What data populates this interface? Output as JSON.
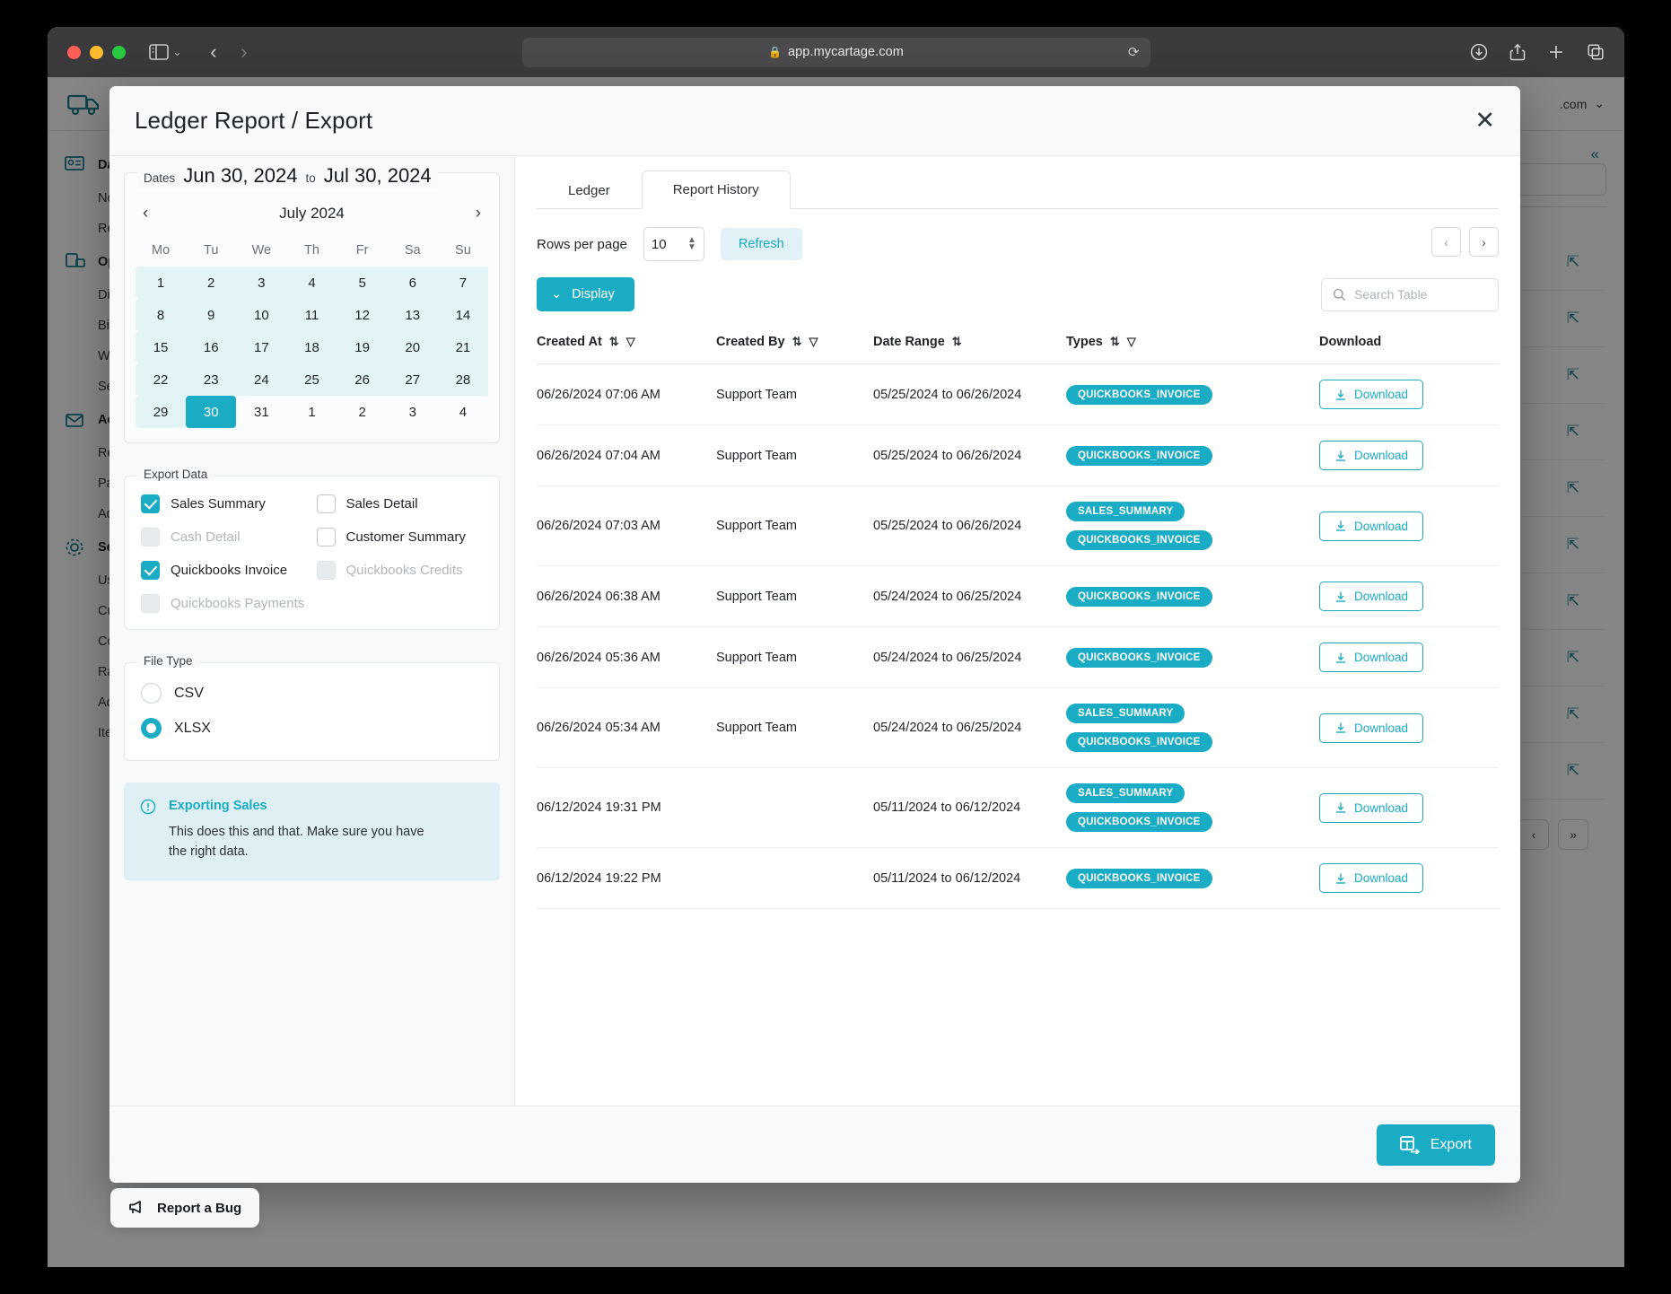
{
  "browser": {
    "url": "app.mycartage.com",
    "lock_icon": "lock-icon",
    "reload_icon": "reload-icon",
    "back_icon": "back-arrow-icon",
    "forward_icon": "forward-arrow-icon",
    "sidebar_icon": "sidebar-toggle-icon",
    "downloads_icon": "downloads-icon",
    "share_icon": "share-icon",
    "newtab_icon": "new-tab-icon",
    "tabs_icon": "tab-overview-icon"
  },
  "app_background": {
    "account_label": ".com",
    "collapse_label": "«",
    "nav": [
      {
        "label": "Da",
        "type": "group",
        "icon": "dashboard-icon"
      },
      {
        "label": "Newsf",
        "type": "item"
      },
      {
        "label": "Report",
        "type": "item"
      },
      {
        "label": "Op",
        "type": "group",
        "icon": "operations-icon"
      },
      {
        "label": "Dispat",
        "type": "item"
      },
      {
        "label": "Billing",
        "type": "item"
      },
      {
        "label": "Wareh",
        "type": "item"
      },
      {
        "label": "Search",
        "type": "item"
      },
      {
        "label": "Ac",
        "type": "group",
        "icon": "accounting-icon"
      },
      {
        "label": "Receiv",
        "type": "item"
      },
      {
        "label": "Payme",
        "type": "item"
      },
      {
        "label": "Adjust",
        "type": "item"
      },
      {
        "label": "Se",
        "type": "group",
        "icon": "settings-gear-icon"
      },
      {
        "label": "Users",
        "type": "item"
      },
      {
        "label": "Custor",
        "type": "item"
      },
      {
        "label": "Codes",
        "type": "item"
      },
      {
        "label": "Rates",
        "type": "item"
      },
      {
        "label": "Addres",
        "type": "item"
      },
      {
        "label": "Items",
        "type": "item"
      }
    ],
    "pager_next": "»"
  },
  "modal": {
    "title": "Ledger Report / Export",
    "close_icon": "close-icon"
  },
  "dates": {
    "legend_label": "Dates",
    "from": "Jun 30, 2024",
    "to_word": "to",
    "to": "Jul 30, 2024"
  },
  "calendar": {
    "month_label": "July 2024",
    "prev_icon": "chevron-left-icon",
    "next_icon": "chevron-right-icon",
    "weekdays": [
      "Mo",
      "Tu",
      "We",
      "Th",
      "Fr",
      "Sa",
      "Su"
    ],
    "weeks": [
      [
        {
          "d": "1",
          "s": "inrange"
        },
        {
          "d": "2",
          "s": "inrange"
        },
        {
          "d": "3",
          "s": "inrange"
        },
        {
          "d": "4",
          "s": "inrange"
        },
        {
          "d": "5",
          "s": "inrange"
        },
        {
          "d": "6",
          "s": "inrange we"
        },
        {
          "d": "7",
          "s": "inrange we"
        }
      ],
      [
        {
          "d": "8",
          "s": "inrange"
        },
        {
          "d": "9",
          "s": "inrange"
        },
        {
          "d": "10",
          "s": "inrange"
        },
        {
          "d": "11",
          "s": "inrange"
        },
        {
          "d": "12",
          "s": "inrange"
        },
        {
          "d": "13",
          "s": "inrange we"
        },
        {
          "d": "14",
          "s": "inrange we"
        }
      ],
      [
        {
          "d": "15",
          "s": "inrange"
        },
        {
          "d": "16",
          "s": "inrange"
        },
        {
          "d": "17",
          "s": "inrange"
        },
        {
          "d": "18",
          "s": "inrange"
        },
        {
          "d": "19",
          "s": "inrange"
        },
        {
          "d": "20",
          "s": "inrange we"
        },
        {
          "d": "21",
          "s": "inrange we"
        }
      ],
      [
        {
          "d": "22",
          "s": "inrange"
        },
        {
          "d": "23",
          "s": "inrange"
        },
        {
          "d": "24",
          "s": "inrange"
        },
        {
          "d": "25",
          "s": "inrange"
        },
        {
          "d": "26",
          "s": "inrange"
        },
        {
          "d": "27",
          "s": "inrange we"
        },
        {
          "d": "28",
          "s": "inrange we"
        }
      ],
      [
        {
          "d": "29",
          "s": "inrange"
        },
        {
          "d": "30",
          "s": "selected"
        },
        {
          "d": "31",
          "s": ""
        },
        {
          "d": "1",
          "s": "out"
        },
        {
          "d": "2",
          "s": "out"
        },
        {
          "d": "3",
          "s": "out"
        },
        {
          "d": "4",
          "s": "out"
        }
      ]
    ]
  },
  "export_data": {
    "legend": "Export Data",
    "options": [
      {
        "label": "Sales Summary",
        "checked": true,
        "disabled": false
      },
      {
        "label": "Sales Detail",
        "checked": false,
        "disabled": false
      },
      {
        "label": "Cash Detail",
        "checked": false,
        "disabled": true
      },
      {
        "label": "Customer Summary",
        "checked": false,
        "disabled": false
      },
      {
        "label": "Quickbooks Invoice",
        "checked": true,
        "disabled": false
      },
      {
        "label": "Quickbooks Credits",
        "checked": false,
        "disabled": true
      },
      {
        "label": "Quickbooks Payments",
        "checked": false,
        "disabled": true
      }
    ]
  },
  "file_type": {
    "legend": "File Type",
    "options": [
      {
        "label": "CSV",
        "selected": false
      },
      {
        "label": "XLSX",
        "selected": true
      }
    ]
  },
  "info": {
    "icon": "info-circle-icon",
    "title": "Exporting Sales",
    "text": "This does this and that. Make sure you have the right data."
  },
  "tabs": [
    {
      "label": "Ledger",
      "active": false
    },
    {
      "label": "Report History",
      "active": true
    }
  ],
  "toolbar": {
    "rows_per_page_label": "Rows per page",
    "rows_per_page_value": "10",
    "refresh_label": "Refresh",
    "display_label": "Display",
    "display_icon": "chevron-down-icon",
    "prev_page_icon": "chevron-left-icon",
    "next_page_icon": "chevron-right-icon",
    "search_placeholder": "Search Table",
    "search_value": "",
    "search_icon": "search-icon"
  },
  "table": {
    "columns": [
      {
        "label": "Created At",
        "sort": true,
        "filter": true
      },
      {
        "label": "Created By",
        "sort": true,
        "filter": true
      },
      {
        "label": "Date Range",
        "sort": true,
        "filter": false
      },
      {
        "label": "Types",
        "sort": true,
        "filter": true
      },
      {
        "label": "Download",
        "sort": false,
        "filter": false
      }
    ],
    "download_label": "Download",
    "download_icon": "download-icon",
    "rows": [
      {
        "created_at": "06/26/2024 07:06 AM",
        "created_by": "Support Team",
        "date_range": "05/25/2024 to 06/26/2024",
        "types": [
          "QUICKBOOKS_INVOICE"
        ]
      },
      {
        "created_at": "06/26/2024 07:04 AM",
        "created_by": "Support Team",
        "date_range": "05/25/2024 to 06/26/2024",
        "types": [
          "QUICKBOOKS_INVOICE"
        ]
      },
      {
        "created_at": "06/26/2024 07:03 AM",
        "created_by": "Support Team",
        "date_range": "05/25/2024 to 06/26/2024",
        "types": [
          "SALES_SUMMARY",
          "QUICKBOOKS_INVOICE"
        ]
      },
      {
        "created_at": "06/26/2024 06:38 AM",
        "created_by": "Support Team",
        "date_range": "05/24/2024 to 06/25/2024",
        "types": [
          "QUICKBOOKS_INVOICE"
        ]
      },
      {
        "created_at": "06/26/2024 05:36 AM",
        "created_by": "Support Team",
        "date_range": "05/24/2024 to 06/25/2024",
        "types": [
          "QUICKBOOKS_INVOICE"
        ]
      },
      {
        "created_at": "06/26/2024 05:34 AM",
        "created_by": "Support Team",
        "date_range": "05/24/2024 to 06/25/2024",
        "types": [
          "SALES_SUMMARY",
          "QUICKBOOKS_INVOICE"
        ]
      },
      {
        "created_at": "06/12/2024 19:31 PM",
        "created_by": "",
        "date_range": "05/11/2024 to 06/12/2024",
        "types": [
          "SALES_SUMMARY",
          "QUICKBOOKS_INVOICE"
        ]
      },
      {
        "created_at": "06/12/2024 19:22 PM",
        "created_by": "",
        "date_range": "05/11/2024 to 06/12/2024",
        "types": [
          "QUICKBOOKS_INVOICE"
        ]
      }
    ]
  },
  "footer": {
    "export_label": "Export",
    "export_icon": "export-table-icon"
  },
  "bug": {
    "label": "Report a Bug",
    "icon": "megaphone-icon"
  },
  "colors": {
    "accent": "#1aacc4",
    "accent_soft": "#e1f2f6",
    "range": "#e2f4f6",
    "weekend": "#f4615a",
    "panel": "#f7f9fa"
  }
}
